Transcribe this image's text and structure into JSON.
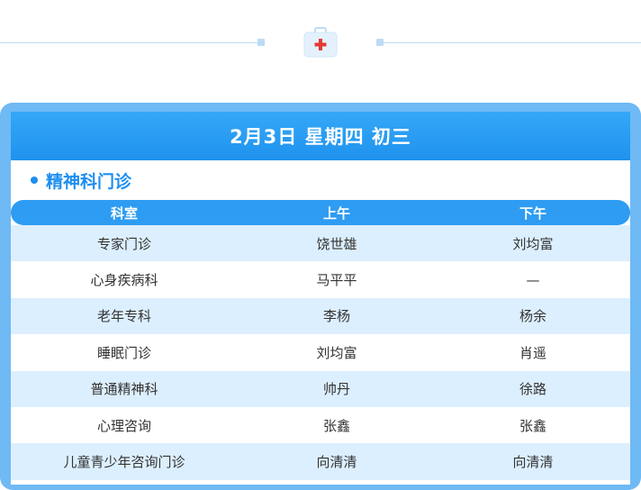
{
  "header": {
    "date_text": "2月3日  星期四  初三"
  },
  "department": {
    "title": "精神科门诊"
  },
  "table": {
    "columns": [
      "科室",
      "上午",
      "下午"
    ],
    "rows": [
      [
        "专家门诊",
        "饶世雄",
        "刘均富"
      ],
      [
        "心身疾病科",
        "马平平",
        "—"
      ],
      [
        "老年专科",
        "李杨",
        "杨余"
      ],
      [
        "睡眠门诊",
        "刘均富",
        "肖遥"
      ],
      [
        "普通精神科",
        "帅丹",
        "徐路"
      ],
      [
        "心理咨询",
        "张鑫",
        "张鑫"
      ],
      [
        "儿童青少年咨询门诊",
        "向清清",
        "向清清"
      ]
    ]
  },
  "icons": {
    "divider_icon": "medical-kit-icon"
  },
  "colors": {
    "accent": "#2e9cf2",
    "frame": "#6fb9f5",
    "row_alt": "#dcefff",
    "divider": "#bcdcf5",
    "medkit_cross": "#e53935"
  }
}
